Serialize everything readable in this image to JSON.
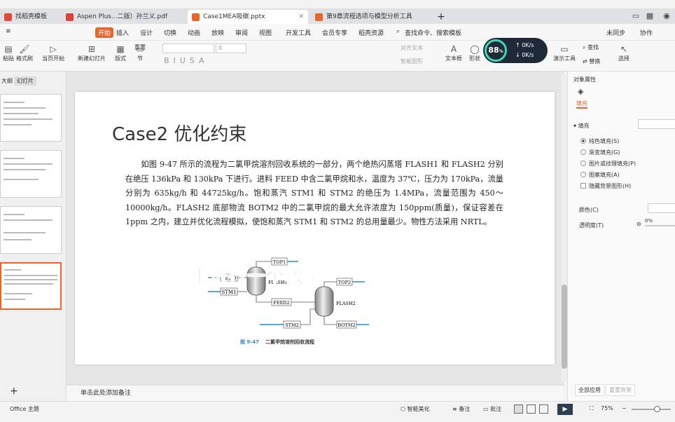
{
  "tabs": [
    {
      "label": "找稻壳模板",
      "color": "#e04a3a"
    },
    {
      "label": "Aspen Plus...二版）孙兰义.pdf",
      "color": "#d9443a"
    },
    {
      "label": "Case1MEA吸碳.pptx",
      "color": "#e8662e"
    },
    {
      "label": "第9章流程选项与模型分析工具",
      "color": "#e8662e"
    }
  ],
  "menu": {
    "items": [
      "开始",
      "插入",
      "设计",
      "切换",
      "动画",
      "放映",
      "审阅",
      "视图",
      "开发工具",
      "会员专享",
      "稻壳资源"
    ],
    "search": "查找命令、搜索模板",
    "right": [
      "未同步",
      "协作"
    ]
  },
  "toolbar": {
    "items": [
      "粘贴",
      "格式刷",
      "当页开始",
      "新建幻灯片",
      "版式",
      "节",
      "重置",
      "文本框",
      "形状",
      "演示工具",
      "查找",
      "替换",
      "选择"
    ],
    "font_size": "0",
    "align_label": "对齐文本",
    "smart_label": "智能图形"
  },
  "perf": {
    "percent": "88",
    "up": "0K/s",
    "down": "0K/s"
  },
  "left_panel": {
    "tab_outline": "大纲",
    "tab_slides": "幻灯片",
    "add": "+"
  },
  "slide": {
    "title": "Case2 优化约束",
    "paragraph": "如图 9-47 所示的流程为二氯甲烷溶剂回收系统的一部分，两个绝热闪蒸塔 FLASH1 和 FLASH2 分别在绝压 136kPa 和 130kPa 下进行。进料 FEED 中含二氯甲烷和水，温度为 37℃，压力为 170kPa，流量分别为 635kg/h 和 44725kg/h。饱和蒸汽 STM1 和 STM2 的绝压为 1.4MPa，流量范围为 450～10000kg/h。FLASH2 底部物流 BOTM2 中的二氯甲烷的最大允许浓度为 150ppm(质量)，保证容差在 1ppm 之内，建立并优化流程模拟，使饱和蒸汽 STM1 和 STM2 的总用量最少。物性方法采用 NRTL。",
    "diagram": {
      "streams": [
        "FEED",
        "STM1",
        "TOP1",
        "FEED2",
        "TOP2",
        "STM2",
        "BOTM2"
      ],
      "blocks": [
        "FLASH1",
        "FLASH2"
      ],
      "caption_num": "图 9-47",
      "caption": "二氯甲烷溶剂回收流程"
    }
  },
  "subtitle": "来进行一个教学",
  "notes_placeholder": "单击此处添加备注",
  "right_panel": {
    "header": "对象属性",
    "tab": "填充",
    "section": "填充",
    "options": [
      "纯色填充(S)",
      "渐变填充(G)",
      "图片或纹理填充(P)",
      "图案填充(A)"
    ],
    "checkbox": "隐藏背景图形(H)",
    "color_label": "颜色(C)",
    "transparency_label": "透明度(T)",
    "transparency_value": "0%",
    "apply_all": "全部应用",
    "reset_bg": "重置背景"
  },
  "status": {
    "theme": "Office 主题",
    "smart": "智能美化",
    "notes": "备注",
    "comments": "批注",
    "zoom": "75%"
  },
  "colors": {
    "accent": "#e8662e",
    "stream": "#5aa9d6"
  }
}
